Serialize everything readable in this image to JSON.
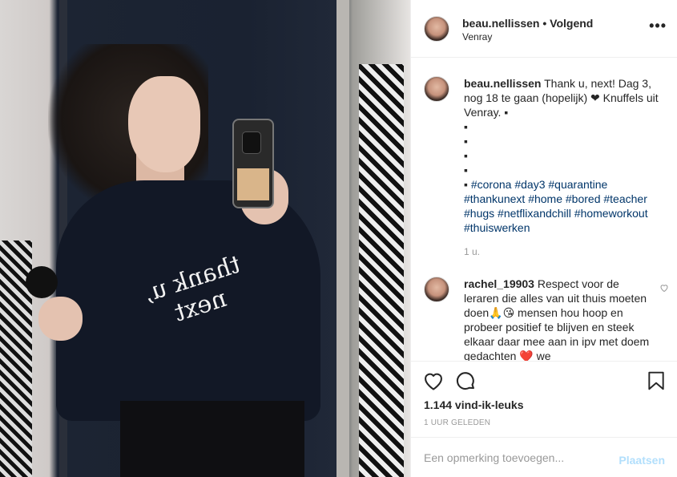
{
  "post": {
    "image_alt": "Photo by beau.nellissen"
  },
  "header": {
    "username": "beau.nellissen",
    "separator": " • ",
    "follow_label": "Volgend",
    "location": "Venray",
    "more_label": "•••"
  },
  "caption": {
    "username": "beau.nellissen",
    "text": "Thank u, next! Dag 3, nog 18 te gaan (hopelijk) ❤ Knuffels uit Venray. ▪",
    "dots": [
      "▪",
      "▪",
      "▪",
      "▪"
    ],
    "bullet": "▪ ",
    "hashtags": [
      "#corona",
      "#day3",
      "#quarantine",
      "#thankunext",
      "#home",
      "#bored",
      "#teacher",
      "#hugs",
      "#netflixandchill",
      "#homeworkout",
      "#thuiswerken"
    ],
    "age": "1 u."
  },
  "comments": [
    {
      "username": "rachel_19903",
      "text": "Respect voor de leraren die alles van uit thuis moeten doen🙏😘 mensen hou hoop en probeer positief te blijven en steek elkaar daar mee aan in ipv met doem gedachten ❤️ we"
    }
  ],
  "actions": {
    "likes": "1.144 vind-ik-leuks",
    "timestamp": "1 UUR GELEDEN"
  },
  "add_comment": {
    "placeholder": "Een opmerking toevoegen...",
    "post_label": "Plaatsen"
  },
  "colors": {
    "hashtag": "#003569",
    "muted": "#999999",
    "post_disabled": "#b2dffc"
  }
}
